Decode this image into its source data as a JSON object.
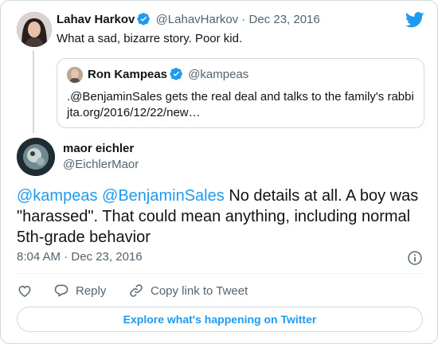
{
  "parent_tweet": {
    "name": "Lahav Harkov",
    "handle": "@LahavHarkov",
    "separator": "·",
    "date": "Dec 23, 2016",
    "text": "What a sad, bizarre story. Poor kid."
  },
  "quoted_tweet": {
    "name": "Ron Kampeas",
    "handle": "@kampeas",
    "text_line1": ".@BenjaminSales gets the real deal and talks to the family's rabbi",
    "text_line2": "jta.org/2016/12/22/new…"
  },
  "main_tweet": {
    "name": "maor eichler",
    "handle": "@EichlerMaor",
    "mention1": "@kampeas",
    "mention2": "@BenjaminSales",
    "body": "No details at all. A boy was \"harassed\".  That could mean anything, including normal 5th-grade behavior",
    "timestamp": "8:04 AM · Dec 23, 2016"
  },
  "actions": {
    "reply_label": "Reply",
    "copy_label": "Copy link to Tweet"
  },
  "footer": {
    "explore_label": "Explore what's happening on Twitter"
  },
  "colors": {
    "accent": "#1d9bf0",
    "verified": "#1d9bf0",
    "secondary_text": "#536471",
    "border": "#cfd9de"
  },
  "icons": [
    "twitter-bird-icon",
    "verified-badge-icon",
    "info-icon",
    "heart-icon",
    "reply-icon",
    "link-icon"
  ]
}
